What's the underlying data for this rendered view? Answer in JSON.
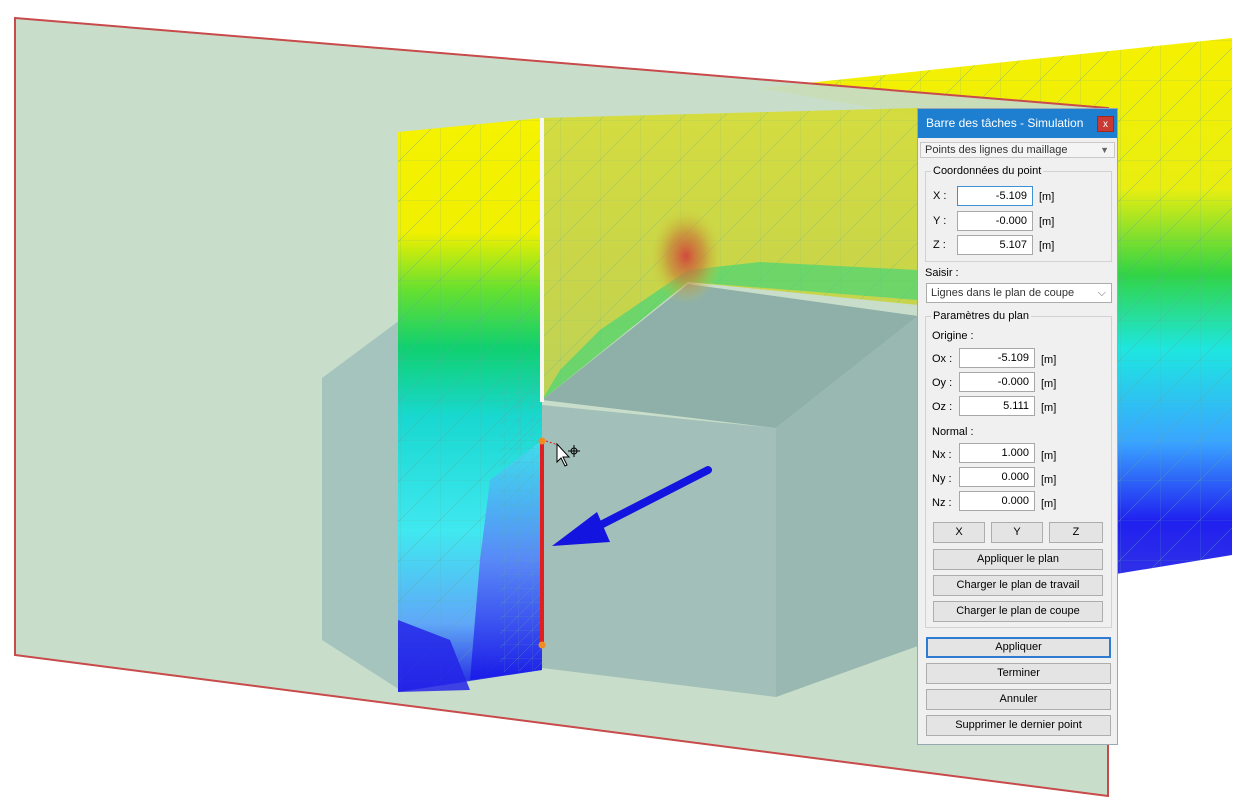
{
  "panel": {
    "title": "Barre des tâches - Simulation",
    "close_label": "x",
    "mode_select": "Points des lignes du maillage",
    "point_coords": {
      "group_title": "Coordonnées du point",
      "x_label": "X :",
      "x_value": "-5.109",
      "y_label": "Y :",
      "y_value": "-0.000",
      "z_label": "Z :",
      "z_value": "5.107",
      "unit": "[m]"
    },
    "saisir": {
      "label": "Saisir :",
      "value": "Lignes dans le plan de coupe"
    },
    "plane_params": {
      "group_title": "Paramètres du plan",
      "origin_label": "Origine :",
      "ox_label": "Ox :",
      "ox_value": "-5.109",
      "oy_label": "Oy :",
      "oy_value": "-0.000",
      "oz_label": "Oz :",
      "oz_value": "5.111",
      "normal_label": "Normal :",
      "nx_label": "Nx :",
      "nx_value": "1.000",
      "ny_label": "Ny :",
      "ny_value": "0.000",
      "nz_label": "Nz :",
      "nz_value": "0.000",
      "unit": "[m]",
      "axis_x": "X",
      "axis_y": "Y",
      "axis_z": "Z",
      "apply_plane": "Appliquer le plan",
      "load_work_plane": "Charger le plan de travail",
      "load_cut_plane": "Charger le plan de coupe"
    },
    "actions": {
      "apply": "Appliquer",
      "finish": "Terminer",
      "cancel": "Annuler",
      "delete_last": "Supprimer le dernier point"
    }
  },
  "colors": {
    "cut_plane_fill": "#c5dcc6",
    "cut_plane_border": "#c84a4a",
    "building": "#9ebdb6",
    "selected_line": "#e02020",
    "arrow": "#1414e0",
    "title_bar": "#1e7fd0"
  }
}
